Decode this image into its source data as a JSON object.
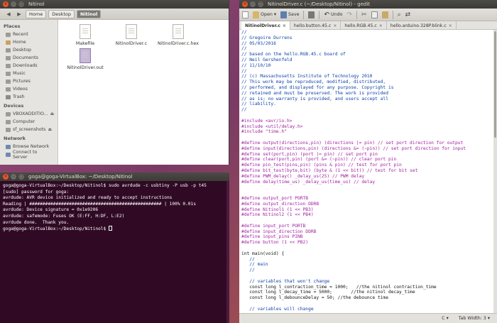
{
  "file_manager": {
    "title": "Nitinol",
    "breadcrumbs": [
      "Home",
      "Desktop",
      "Nitinol"
    ],
    "sidebar": {
      "places_heading": "Places",
      "places": [
        "Recent",
        "Home",
        "Desktop",
        "Documents",
        "Downloads",
        "Music",
        "Pictures",
        "Videos",
        "Trash"
      ],
      "devices_heading": "Devices",
      "devices": [
        "VBOXADDITIO...",
        "Computer",
        "sf_screenshots"
      ],
      "network_heading": "Network",
      "network": [
        "Browse Network",
        "Connect to Server"
      ]
    },
    "files": [
      "Makefile",
      "NitinolDriver.c",
      "NitinolDriver.c.hex",
      "NitinolDriver.out"
    ]
  },
  "terminal": {
    "title": "goga@goga-VirtualBox: ~/Desktop/Nitinol",
    "lines": [
      "goga@goga-VirtualBox:~/Desktop/Nitinol$ sudo avrdude -c usbtiny -P usb -p t45",
      "[sudo] password for goga:",
      "",
      "avrdude: AVR device initialized and ready to accept instructions",
      "",
      "Reading | ################################################## | 100% 0.01s",
      "",
      "avrdude: Device signature = 0x1e9206",
      "",
      "avrdude: safemode: Fuses OK (E:FF, H:DF, L:E2)",
      "",
      "avrdude done.  Thank you.",
      "",
      "goga@goga-VirtualBox:~/Desktop/Nitinol$ "
    ]
  },
  "gedit": {
    "title": "NitinolDriver.c (~/Desktop/Nitinol) - gedit",
    "toolbar": {
      "open": "Open",
      "save": "Save",
      "undo": "Undo"
    },
    "tabs": [
      "NitinolDriver.c",
      "hello.button.45.c",
      "hello.RGB.45.c",
      "hello.arduino.328P.blink.c"
    ],
    "code": [
      [
        "c-comment",
        "//"
      ],
      [
        "c-comment",
        "// Gregoire Durrens"
      ],
      [
        "c-comment",
        "// 05/03/2016"
      ],
      [
        "c-comment",
        "//"
      ],
      [
        "c-comment",
        "// based on the hello.RGB.45.c board of"
      ],
      [
        "c-comment",
        "// Neil Gershenfeld"
      ],
      [
        "c-comment",
        "// 11/10/10"
      ],
      [
        "c-comment",
        "//"
      ],
      [
        "c-comment",
        "// (c) Massachusetts Institute of Technology 2010"
      ],
      [
        "c-comment",
        "// This work may be reproduced, modified, distributed,"
      ],
      [
        "c-comment",
        "// performed, and displayed for any purpose. Copyright is"
      ],
      [
        "c-comment",
        "// retained and must be preserved. The work is provided"
      ],
      [
        "c-comment",
        "// as is; no warranty is provided, and users accept all"
      ],
      [
        "c-comment",
        "// liability."
      ],
      [
        "c-comment",
        "//"
      ],
      [
        "c-plain",
        ""
      ],
      [
        "c-pre",
        "#include <avr/io.h>"
      ],
      [
        "c-pre",
        "#include <util/delay.h>"
      ],
      [
        "c-pre",
        "#include \"time.h\""
      ],
      [
        "c-plain",
        ""
      ],
      [
        "c-pre",
        "#define output(directions,pin) (directions |= pin) // set port direction for output"
      ],
      [
        "c-pre",
        "#define input(directions,pin) (directions &= (~pin)) // set port direction for input"
      ],
      [
        "c-pre",
        "#define set(port,pin) (port |= pin) // set port pin"
      ],
      [
        "c-pre",
        "#define clear(port,pin) (port &= (~pin)) // clear port pin"
      ],
      [
        "c-pre",
        "#define pin_test(pins,pin) (pins & pin) // test for port pin"
      ],
      [
        "c-pre",
        "#define bit_test(byte,bit) (byte & (1 << bit)) // test for bit set"
      ],
      [
        "c-pre",
        "#define PWM_delay() _delay_us(25) // PWM delay"
      ],
      [
        "c-pre",
        "#define delay(time_us) _delay_us(time_us) // delay"
      ],
      [
        "c-plain",
        ""
      ],
      [
        "c-plain",
        ""
      ],
      [
        "c-pre",
        "#define output_port PORTB"
      ],
      [
        "c-pre",
        "#define output_direction DDRB"
      ],
      [
        "c-pre",
        "#define Nitinol1 (1 << PB3)"
      ],
      [
        "c-pre",
        "#define Nitinol2 (1 << PB4)"
      ],
      [
        "c-plain",
        ""
      ],
      [
        "c-pre",
        "#define input_port PORTB"
      ],
      [
        "c-pre",
        "#define input_direction DDRB"
      ],
      [
        "c-pre",
        "#define input_pins PINB"
      ],
      [
        "c-pre",
        "#define button (1 << PB2)"
      ],
      [
        "c-plain",
        ""
      ],
      [
        "c-plain",
        "int main(void) {"
      ],
      [
        "c-comment",
        "   //"
      ],
      [
        "c-comment",
        "   // main"
      ],
      [
        "c-comment",
        "   //"
      ],
      [
        "c-plain",
        ""
      ],
      [
        "c-comment",
        "   // variables that won't change"
      ],
      [
        "c-plain",
        "   const long l_contraction_time = 1000;   //the nitinol contraction_time"
      ],
      [
        "c-plain",
        "   const long l_decay_time = 5000;       //the nitinol decay_time"
      ],
      [
        "c-plain",
        "   const long l_debounceDelay = 50; //the debounce time"
      ],
      [
        "c-plain",
        ""
      ],
      [
        "c-comment",
        "   // variables will change"
      ]
    ],
    "status": {
      "language": "C",
      "tab_width": "Tab Width: 3"
    }
  }
}
